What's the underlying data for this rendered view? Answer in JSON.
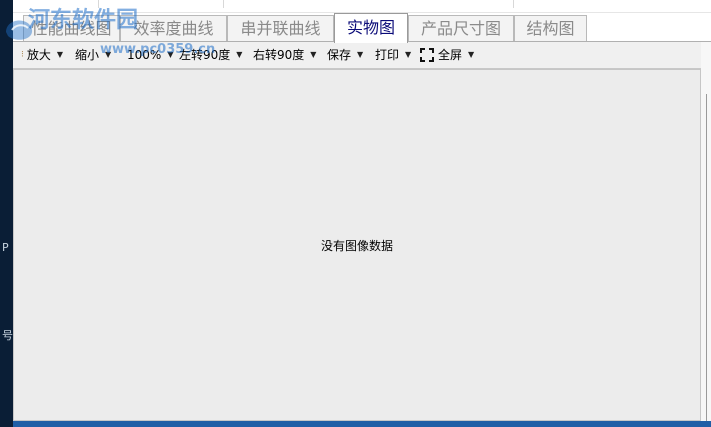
{
  "tabs": [
    {
      "label": "性能曲线图",
      "active": false
    },
    {
      "label": "效率度曲线",
      "active": false
    },
    {
      "label": "串并联曲线",
      "active": false
    },
    {
      "label": "实物图",
      "active": true
    },
    {
      "label": "产品尺寸图",
      "active": false
    },
    {
      "label": "结构图",
      "active": false
    }
  ],
  "toolbar": {
    "zoom_in": "放大",
    "zoom_out": "缩小",
    "zoom_level": "100%",
    "rotate_left": "左转90度",
    "rotate_right": "右转90度",
    "save": "保存",
    "print": "打印",
    "fullscreen": "全屏"
  },
  "viewer": {
    "empty_message": "没有图像数据"
  },
  "watermark": {
    "title": "河东软件园",
    "url": "www.pc0359.cn"
  },
  "left_strip": {
    "mark1": "P",
    "mark2": "号"
  },
  "colors": {
    "accent_blue": "#1f5ea6",
    "active_tab_text": "#0a0a78",
    "inactive_tab_text": "#8a8a8a",
    "viewer_bg": "#ececec",
    "left_strip": "#0a1e36"
  }
}
